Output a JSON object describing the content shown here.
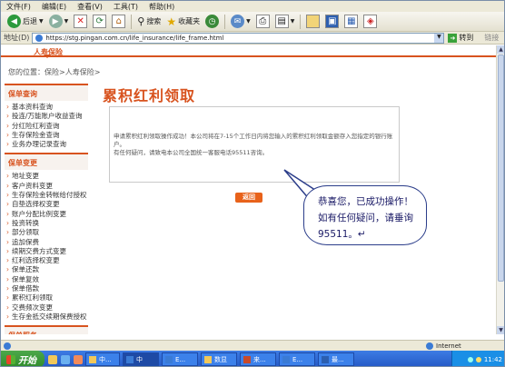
{
  "menu": [
    "文件(F)",
    "编辑(E)",
    "查看(V)",
    "工具(T)",
    "帮助(H)"
  ],
  "toolbar": {
    "back": "后退",
    "search": "搜索",
    "favorites": "收藏夹"
  },
  "address": {
    "label": "地址(D)",
    "url": "https://stg.pingan.com.cn/life_insurance/life_frame.html",
    "go": "转到",
    "links": "链接"
  },
  "topnav": {
    "tab": "人寿保险"
  },
  "breadcrumb": "您的位置：保险>人寿保险>",
  "sidebar": {
    "sections": [
      {
        "title": "保单查询",
        "items": [
          "基本资料查询",
          "投连/万能账户收益查询",
          "分红险红利查询",
          "生存保险金查询",
          "业务办理记录查询"
        ]
      },
      {
        "title": "保单变更",
        "items": [
          "地址变更",
          "客户资料变更",
          "生存保险金转帐给付授权",
          "自垫选择权变更",
          "账户分配比例变更",
          "投资转换",
          "部分领取",
          "追加保费",
          "续期交费方式变更",
          "红利选择权变更",
          "保单还款",
          "保单复效",
          "保单借款",
          "累积红利领取",
          "交费频次变更",
          "生存金抵交续期保费授权"
        ]
      },
      {
        "title": "保单服务",
        "items": []
      }
    ]
  },
  "main": {
    "title": "累积红利领取",
    "message_1": "申请累积红利领取操作成功！本公司将在7-15个工作日内将您输入的累积红利领取金额存入您指定的银行账户。",
    "message_2": "有任何疑问，请致电本公司全国统一客服电话95511咨询。",
    "back_button": "返回"
  },
  "callout": {
    "text": "恭喜您，已成功操作！如有任何疑问，请垂询 95511。↵"
  },
  "status": {
    "zone": "Internet"
  },
  "taskbar": {
    "start": "开始",
    "tasks": [
      "中...",
      "中",
      "E...",
      "数显",
      "来...",
      "E...",
      "最..."
    ],
    "clock": "11:42"
  }
}
